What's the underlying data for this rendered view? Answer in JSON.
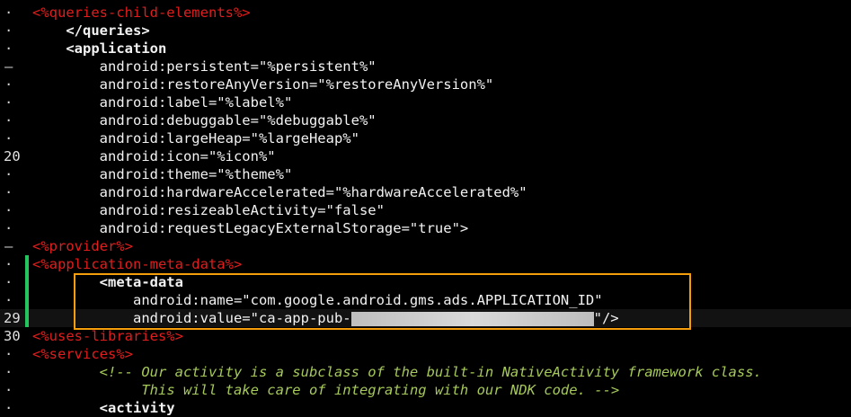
{
  "editor": {
    "lines": [
      {
        "gutter": "·",
        "indent": "",
        "text": "<%queries-child-elements%>",
        "style": "red"
      },
      {
        "gutter": "·",
        "indent": "    ",
        "text": "</queries>",
        "style": "tag"
      },
      {
        "gutter": "·",
        "indent": "    ",
        "text": "<application",
        "style": "tag"
      },
      {
        "gutter": "–",
        "indent": "        ",
        "text": "android:persistent=\"%persistent%\"",
        "style": "white"
      },
      {
        "gutter": "·",
        "indent": "        ",
        "text": "android:restoreAnyVersion=\"%restoreAnyVersion%\"",
        "style": "white"
      },
      {
        "gutter": "·",
        "indent": "        ",
        "text": "android:label=\"%label%\"",
        "style": "white"
      },
      {
        "gutter": "·",
        "indent": "        ",
        "text": "android:debuggable=\"%debuggable%\"",
        "style": "white"
      },
      {
        "gutter": "·",
        "indent": "        ",
        "text": "android:largeHeap=\"%largeHeap%\"",
        "style": "white"
      },
      {
        "gutter": "20",
        "indent": "        ",
        "text": "android:icon=\"%icon%\"",
        "style": "white"
      },
      {
        "gutter": "·",
        "indent": "        ",
        "text": "android:theme=\"%theme%\"",
        "style": "white"
      },
      {
        "gutter": "·",
        "indent": "        ",
        "text": "android:hardwareAccelerated=\"%hardwareAccelerated%\"",
        "style": "white"
      },
      {
        "gutter": "·",
        "indent": "        ",
        "text": "android:resizeableActivity=\"false\"",
        "style": "white"
      },
      {
        "gutter": "·",
        "indent": "        ",
        "text": "android:requestLegacyExternalStorage=\"true\">",
        "style": "white"
      },
      {
        "gutter": "–",
        "indent": "",
        "text": "<%provider%>",
        "style": "red"
      },
      {
        "gutter": "·",
        "indent": "",
        "text": "<%application-meta-data%>",
        "style": "red",
        "modified": true
      },
      {
        "gutter": "·",
        "indent": "        ",
        "text": "<meta-data",
        "style": "tag",
        "modified": true
      },
      {
        "gutter": "·",
        "indent": "            ",
        "text": "android:name=\"com.google.android.gms.ads.APPLICATION_ID\"",
        "style": "white",
        "modified": true
      },
      {
        "gutter": "29",
        "indent": "            ",
        "text": "android:value=\"ca-app-pub-",
        "redacted": true,
        "suffix": "\"/>",
        "style": "white",
        "modified": true,
        "current": true
      },
      {
        "gutter": "30",
        "indent": "",
        "text": "<%uses-libraries%>",
        "style": "red"
      },
      {
        "gutter": "·",
        "indent": "",
        "text": "<%services%>",
        "style": "red"
      },
      {
        "gutter": "·",
        "indent": "        ",
        "text": "<!-- Our activity is a subclass of the built-in NativeActivity framework class.",
        "style": "comment"
      },
      {
        "gutter": "·",
        "indent": "             ",
        "text": "This will take care of integrating with our NDK code. -->",
        "style": "comment"
      },
      {
        "gutter": "·",
        "indent": "        ",
        "text": "<activity",
        "style": "tag"
      }
    ]
  },
  "colors": {
    "background": "#000000",
    "template_placeholder": "#e11d1d",
    "comment": "#a6c95a",
    "modified_marker": "#22c55e",
    "highlight_box": "#f59e0b"
  }
}
